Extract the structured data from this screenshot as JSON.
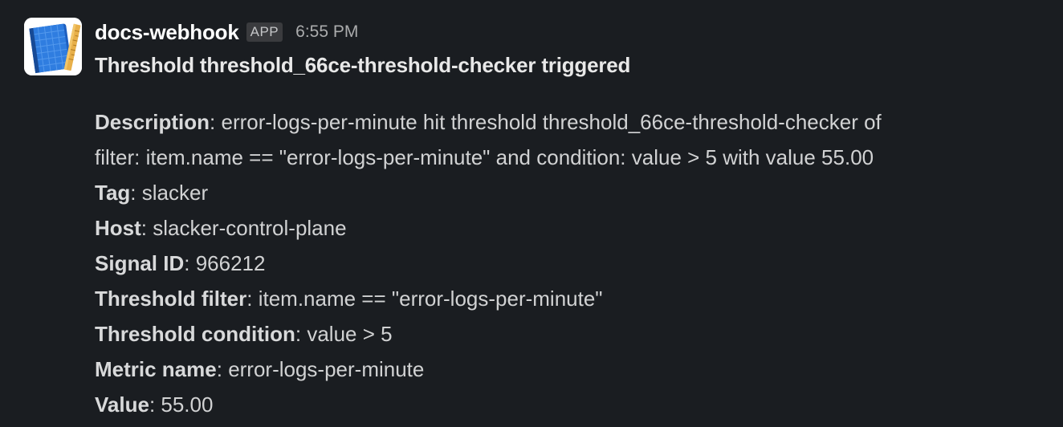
{
  "message": {
    "sender": "docs-webhook",
    "badge": "APP",
    "timestamp": "6:55 PM",
    "avatar_icon": "notebook-pencil-icon",
    "title": "Threshold threshold_66ce-threshold-checker triggered",
    "fields": [
      {
        "label": "Description",
        "lines": [
          "error-logs-per-minute hit threshold threshold_66ce-threshold-checker of",
          "filter: item.name == \"error-logs-per-minute\" and condition: value > 5 with value 55.00"
        ]
      },
      {
        "label": "Tag",
        "value": "slacker"
      },
      {
        "label": "Host",
        "value": "slacker-control-plane"
      },
      {
        "label": "Signal ID",
        "value": "966212"
      },
      {
        "label": "Threshold filter",
        "value": "item.name == \"error-logs-per-minute\""
      },
      {
        "label": "Threshold condition",
        "value": "value > 5"
      },
      {
        "label": "Metric name",
        "value": "error-logs-per-minute"
      },
      {
        "label": "Value",
        "value": "55.00"
      }
    ]
  },
  "colors": {
    "background": "#1a1d21",
    "sender": "#ffffff",
    "text": "#d1d2d3",
    "badge_bg": "#3a3b3e"
  }
}
